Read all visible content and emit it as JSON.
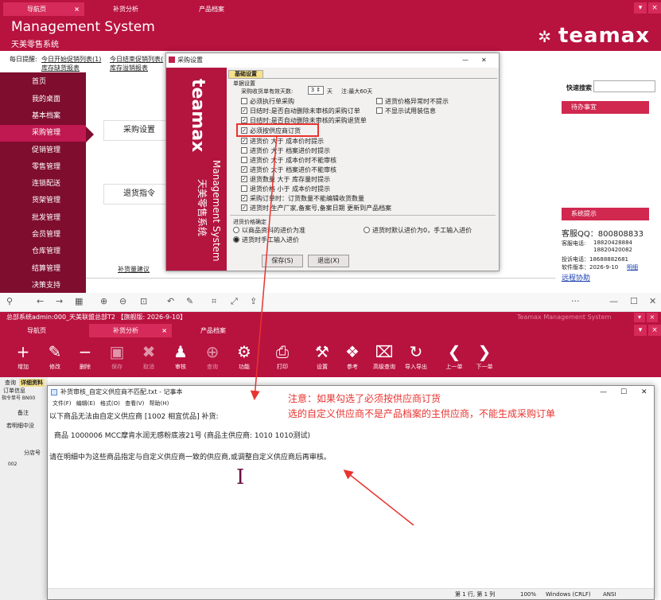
{
  "top_tabs": [
    {
      "label": "导航页"
    },
    {
      "label": "补货分析"
    },
    {
      "label": "产品档案"
    }
  ],
  "header": {
    "title": "Management System",
    "subtitle": "天美零售系统",
    "logo": "teamax"
  },
  "reminder": {
    "label": "每日提醒:",
    "links": [
      "今日开始促销列表(1)",
      "今日结束促销列表(",
      "库存缺货报表",
      "库存溢销报表"
    ]
  },
  "sidebar": [
    {
      "label": "首页"
    },
    {
      "label": "我的桌面"
    },
    {
      "label": "基本档案"
    },
    {
      "label": "采购管理"
    },
    {
      "label": "促销管理"
    },
    {
      "label": "零售管理"
    },
    {
      "label": "连锁配送"
    },
    {
      "label": "货架管理"
    },
    {
      "label": "批发管理"
    },
    {
      "label": "会员管理"
    },
    {
      "label": "仓库管理"
    },
    {
      "label": "结算管理"
    },
    {
      "label": "决策支持"
    }
  ],
  "content": {
    "purchase_settings": "采购设置",
    "return_order": "退货指令",
    "replenish_suggest": "补货量建议"
  },
  "rpanel": {
    "search_label": "快速搜索",
    "todo": "待办事宜",
    "sys_notice": "系统提示",
    "qq": "客服QQ：800808833",
    "phone_label": "客服电话:",
    "phone1": "18820428884",
    "phone2": "18820420082",
    "complaint": "投诉电话：18688882681",
    "version": "软件版本：2026-9-10",
    "version_link": "明细",
    "remote": "远程协助"
  },
  "dialog": {
    "title": "采购设置",
    "side_logo": "teamax",
    "side_text": "Management System",
    "side_cn": "天美零售系统",
    "tab": "基础设置",
    "group1": "单据设置",
    "valid_days_label": "采购收货单有效天数:",
    "valid_days": "3",
    "days_unit": "天",
    "max_note": "注:最大60天",
    "options": [
      {
        "label": "必须执行单采购",
        "checked": false
      },
      {
        "label": "进货价格异常时不提示",
        "checked": false
      },
      {
        "label": "日结时:是否自动删除未审核的采购订单",
        "checked": true
      },
      {
        "label": "不显示试用装信息",
        "checked": false
      },
      {
        "label": "日结时:是否自动删除未审核的采购退货单",
        "checked": true
      },
      {
        "label": "必须按供应商订货",
        "checked": true
      },
      {
        "label": "进货价 大于 成本价时提示",
        "checked": true
      },
      {
        "label": "进货价 大于 档案进价时提示",
        "checked": false
      },
      {
        "label": "进货价 大于 成本价时不能审核",
        "checked": false
      },
      {
        "label": "进货价 大于 档案进价不能审核",
        "checked": true
      },
      {
        "label": "退货数量 大于 库存量时提示",
        "checked": true
      },
      {
        "label": "退货价格 小于 成本价时提示",
        "checked": false
      },
      {
        "label": "采购订单时：订货数量不能编辑收货数量",
        "checked": true
      },
      {
        "label": "进货时 生产厂家,备案号,备案日期 更新到产品档案",
        "checked": true
      }
    ],
    "group2": "进货价格确定",
    "radio1": "以商品资料的进价为准",
    "radio2": "进货时默认进价为0，手工输入进价",
    "radio3": "进货时手工输入进价",
    "save": "保存(S)",
    "exit": "退出(X)"
  },
  "browser": {
    "more": "···"
  },
  "bottom": {
    "status": "总部系统admin:000_天美联盟总部T2   【旗舰版: 2026-9-10】",
    "status_right": "Teamax Management System",
    "tabs": [
      {
        "label": "导航页"
      },
      {
        "label": "补货分析"
      },
      {
        "label": "产品档案"
      }
    ],
    "tools": [
      {
        "icon": "+",
        "label": "增加"
      },
      {
        "icon": "✎",
        "label": "修改"
      },
      {
        "icon": "−",
        "label": "删除"
      },
      {
        "icon": "▣",
        "label": "保存"
      },
      {
        "icon": "✖",
        "label": "取消"
      },
      {
        "icon": "♟",
        "label": "审核"
      },
      {
        "icon": "⊕",
        "label": "查询"
      },
      {
        "icon": "⚙",
        "label": "功能"
      },
      {
        "icon": "⎙",
        "label": "打印"
      },
      {
        "icon": "⚒",
        "label": "设置"
      },
      {
        "icon": "❖",
        "label": "参考"
      },
      {
        "icon": "⌧",
        "label": "高级查询"
      },
      {
        "icon": "↻",
        "label": "导入导出"
      },
      {
        "icon": "❮",
        "label": "上一单"
      },
      {
        "icon": "❯",
        "label": "下一单"
      }
    ],
    "form": {
      "tab1": "查询",
      "tab2": "详细资料",
      "order_info": "订单信息",
      "order_no": "指令单号 BN00",
      "remark": "备注",
      "detail": "若明细中没",
      "col": "分店号",
      "row": "002"
    }
  },
  "notepad": {
    "title": "补货审核_自定义供应商不匹配.txt - 记事本",
    "menu": [
      "文件(F)",
      "编辑(E)",
      "格式(O)",
      "查看(V)",
      "帮助(H)"
    ],
    "line1": "以下商品无法由自定义供应商 [1002 相宜优品] 补货:",
    "line2": "商品 1000006 MCC摩肯水润无感粉底液21号 (商品主供应商: 1010 1010测试)",
    "line3": "请在明细中为这些商品指定与自定义供应商一致的供应商,或调整自定义供应商后再审核。",
    "status": {
      "pos": "第 1 行, 第 1 列",
      "zoom": "100%",
      "eol": "Windows (CRLF)",
      "enc": "ANSI"
    }
  },
  "annotation": {
    "line1": "注意：如果勾选了必须按供应商订货",
    "line2": "选的自定义供应商不是产品档案的主供应商，不能生成采购订单"
  },
  "colors": {
    "brand": "#b8123f",
    "annotation": "#e8332f"
  }
}
